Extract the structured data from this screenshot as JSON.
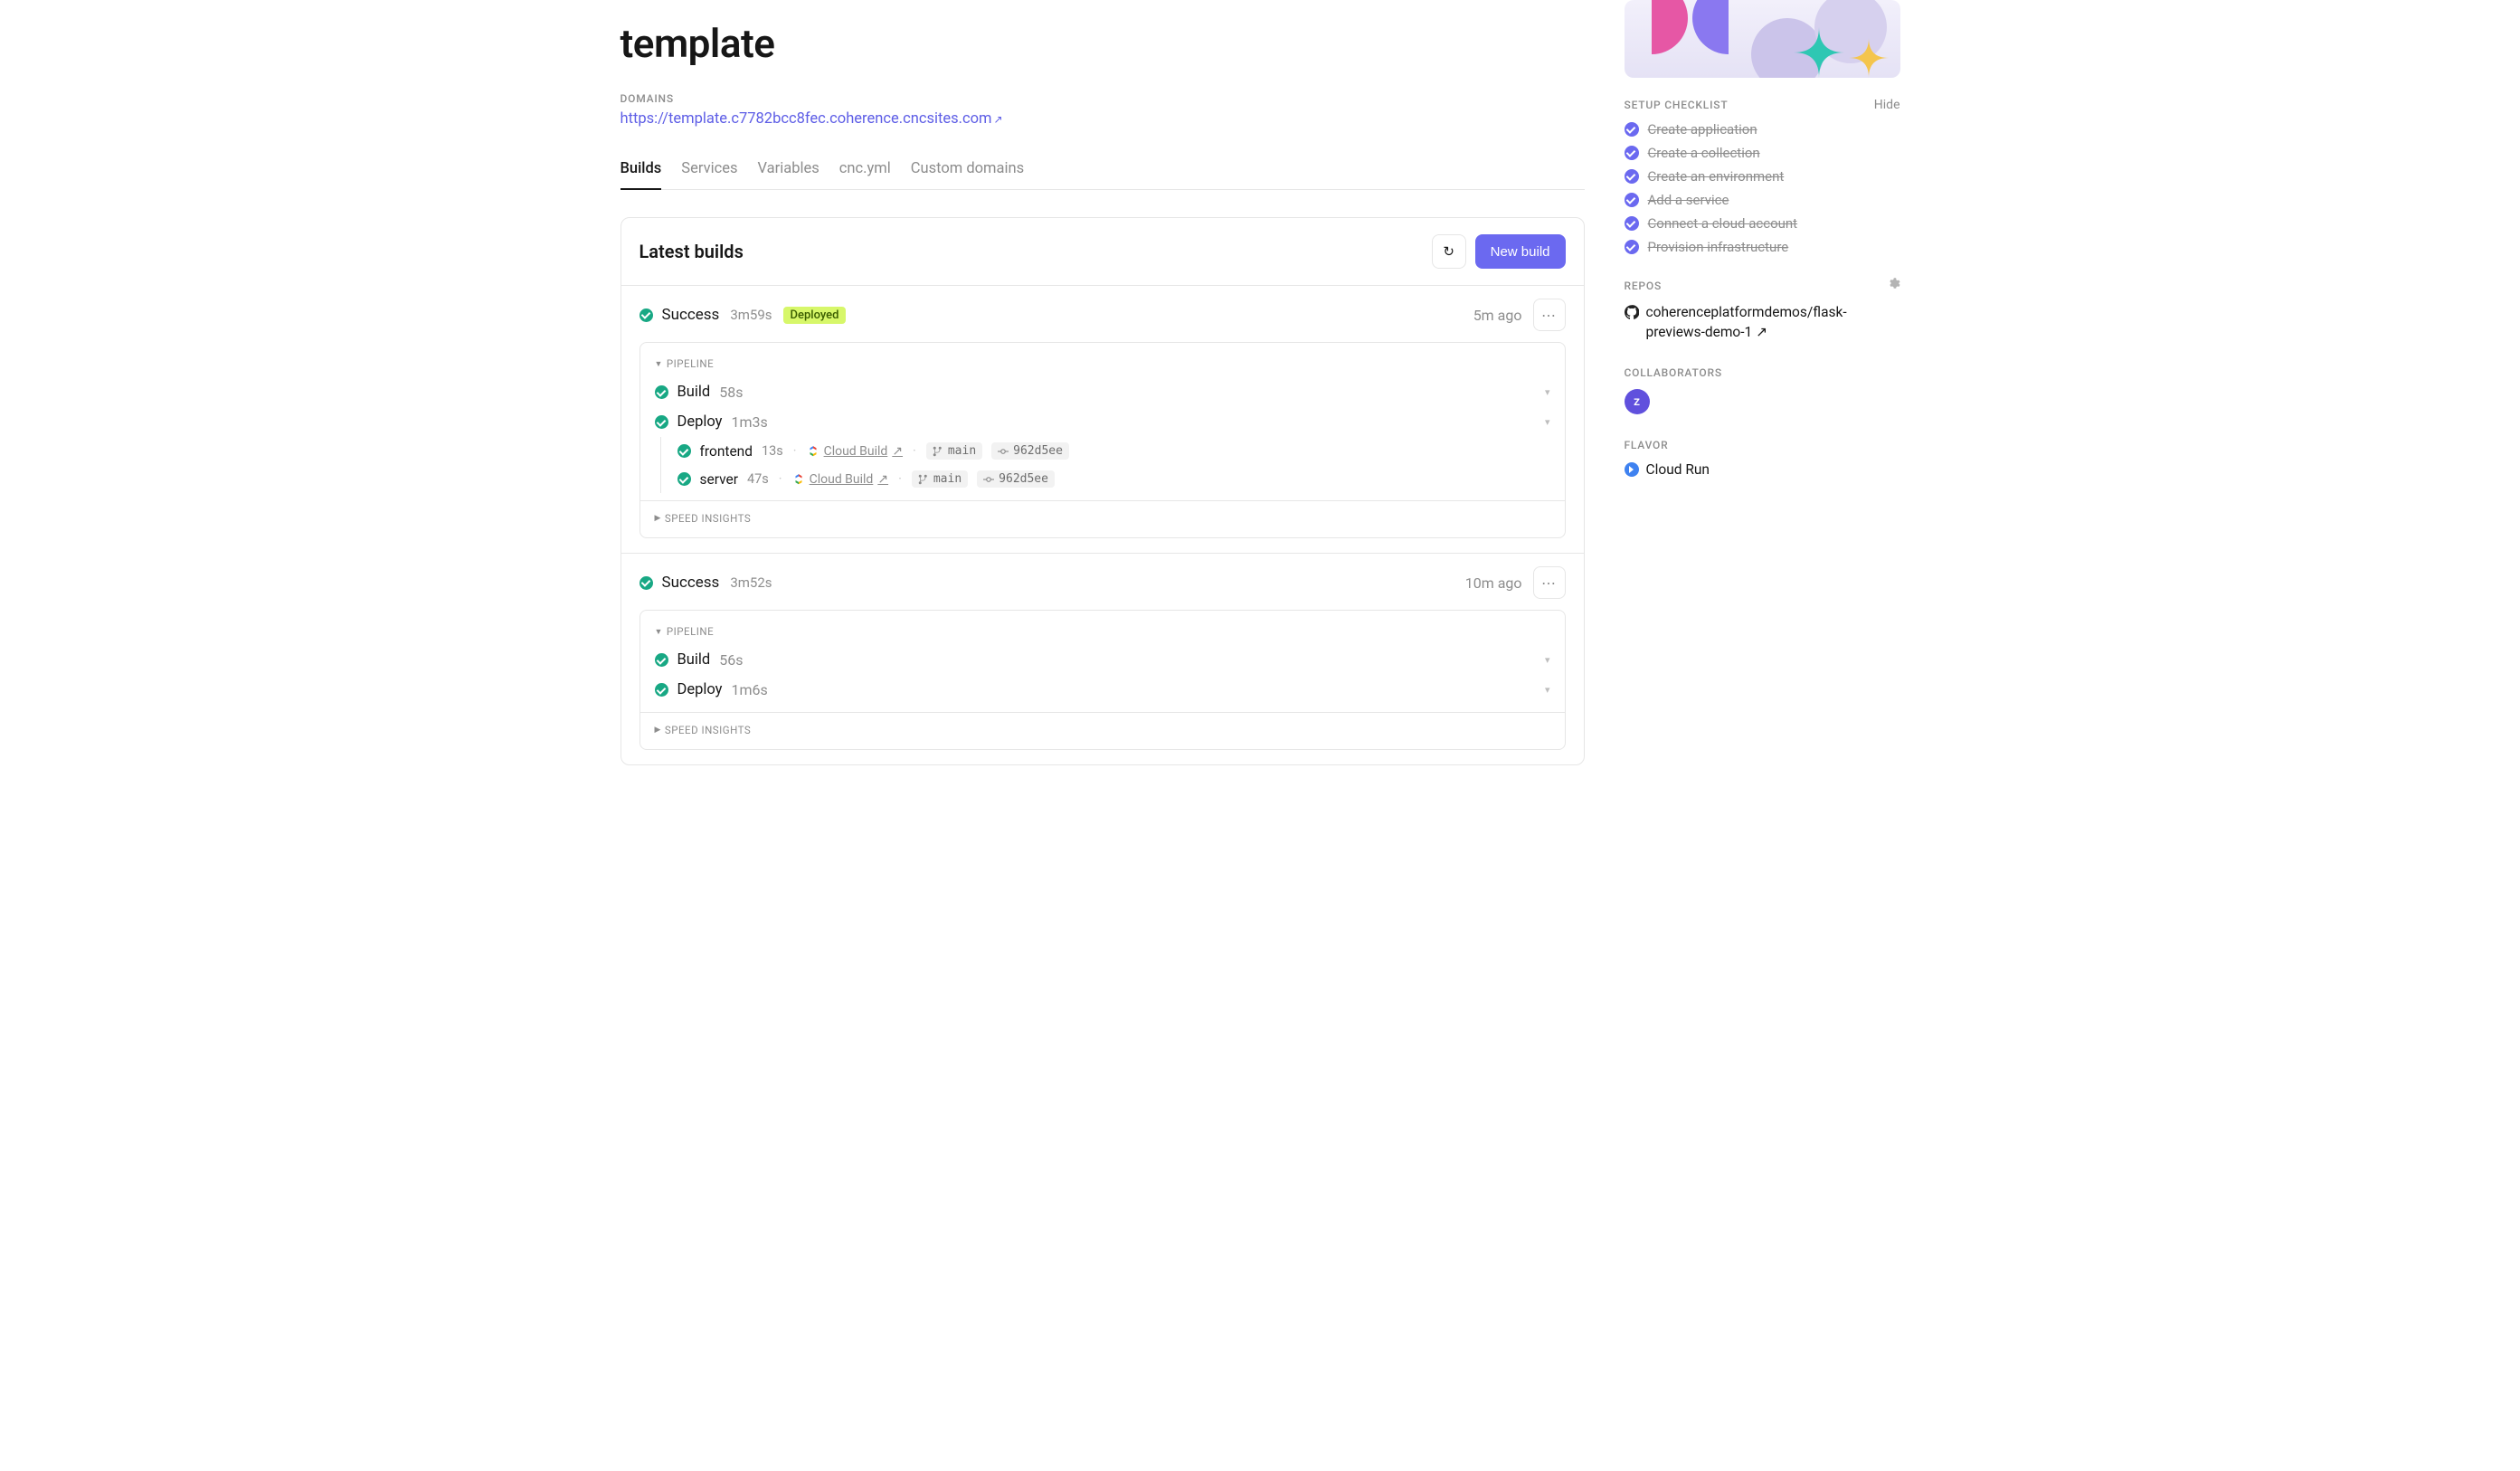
{
  "title": "template",
  "domains_label": "DOMAINS",
  "domain_url": "https://template.c7782bcc8fec.coherence.cncsites.com",
  "external_glyph": "↗",
  "tabs": [
    {
      "label": "Builds",
      "active": true
    },
    {
      "label": "Services",
      "active": false
    },
    {
      "label": "Variables",
      "active": false
    },
    {
      "label": "cnc.yml",
      "active": false
    },
    {
      "label": "Custom domains",
      "active": false
    }
  ],
  "panel": {
    "title": "Latest builds",
    "refresh_glyph": "↻",
    "new_build_label": "New build"
  },
  "labels": {
    "pipeline": "PIPELINE",
    "speed_insights": "SPEED INSIGHTS",
    "cloud_build": "Cloud Build",
    "more": "⋯"
  },
  "builds": [
    {
      "status": "Success",
      "duration": "3m59s",
      "deployed": true,
      "deployed_label": "Deployed",
      "ago": "5m ago",
      "stages": [
        {
          "name": "Build",
          "duration": "58s"
        },
        {
          "name": "Deploy",
          "duration": "1m3s",
          "expanded": true,
          "substeps": [
            {
              "name": "frontend",
              "duration": "13s",
              "branch": "main",
              "commit": "962d5ee"
            },
            {
              "name": "server",
              "duration": "47s",
              "branch": "main",
              "commit": "962d5ee"
            }
          ]
        }
      ]
    },
    {
      "status": "Success",
      "duration": "3m52s",
      "deployed": false,
      "ago": "10m ago",
      "stages": [
        {
          "name": "Build",
          "duration": "56s"
        },
        {
          "name": "Deploy",
          "duration": "1m6s"
        }
      ]
    }
  ],
  "sidebar": {
    "checklist_label": "SETUP CHECKLIST",
    "hide_label": "Hide",
    "checklist": [
      "Create application",
      "Create a collection",
      "Create an environment",
      "Add a service",
      "Connect a cloud account",
      "Provision infrastructure"
    ],
    "repos_label": "REPOS",
    "repo": "coherenceplatformdemos/flask-previews-demo-1",
    "collaborators_label": "COLLABORATORS",
    "collaborator_initial": "z",
    "flavor_label": "FLAVOR",
    "flavor": "Cloud Run"
  }
}
